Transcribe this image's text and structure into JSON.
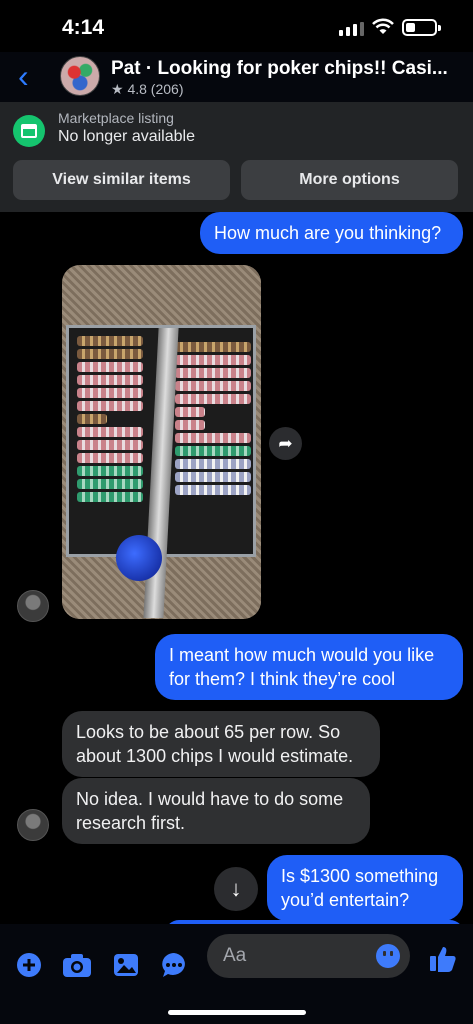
{
  "status_bar": {
    "time": "4:14"
  },
  "header": {
    "title": "Pat · Looking for poker chips!! Casi...",
    "rating": "★ 4.8 (206)"
  },
  "marketplace": {
    "label": "Marketplace listing",
    "status": "No longer available",
    "view_similar": "View similar items",
    "more_options": "More options"
  },
  "messages": {
    "m1": "How much are you thinking?",
    "m2": "I meant how much would you like for them?  I think they’re cool",
    "m3": "Looks to be about 65 per row.  So about 1300 chips I would estimate.",
    "m4": "No idea. I would have to do some research first.",
    "m5": "Is $1300 something you’d entertain?"
  },
  "composer": {
    "placeholder": "Aa"
  },
  "icons": {
    "back": "chevron-left-icon",
    "add": "plus-circle-icon",
    "camera": "camera-icon",
    "gallery": "image-icon",
    "chat": "chat-bubble-icon",
    "emoji": "smiley-icon",
    "like": "thumbs-up-icon",
    "share": "share-arrow-icon",
    "scroll": "arrow-down-icon"
  },
  "colors": {
    "accent": "#1f5ef6",
    "marketplace": "#15c46e"
  }
}
